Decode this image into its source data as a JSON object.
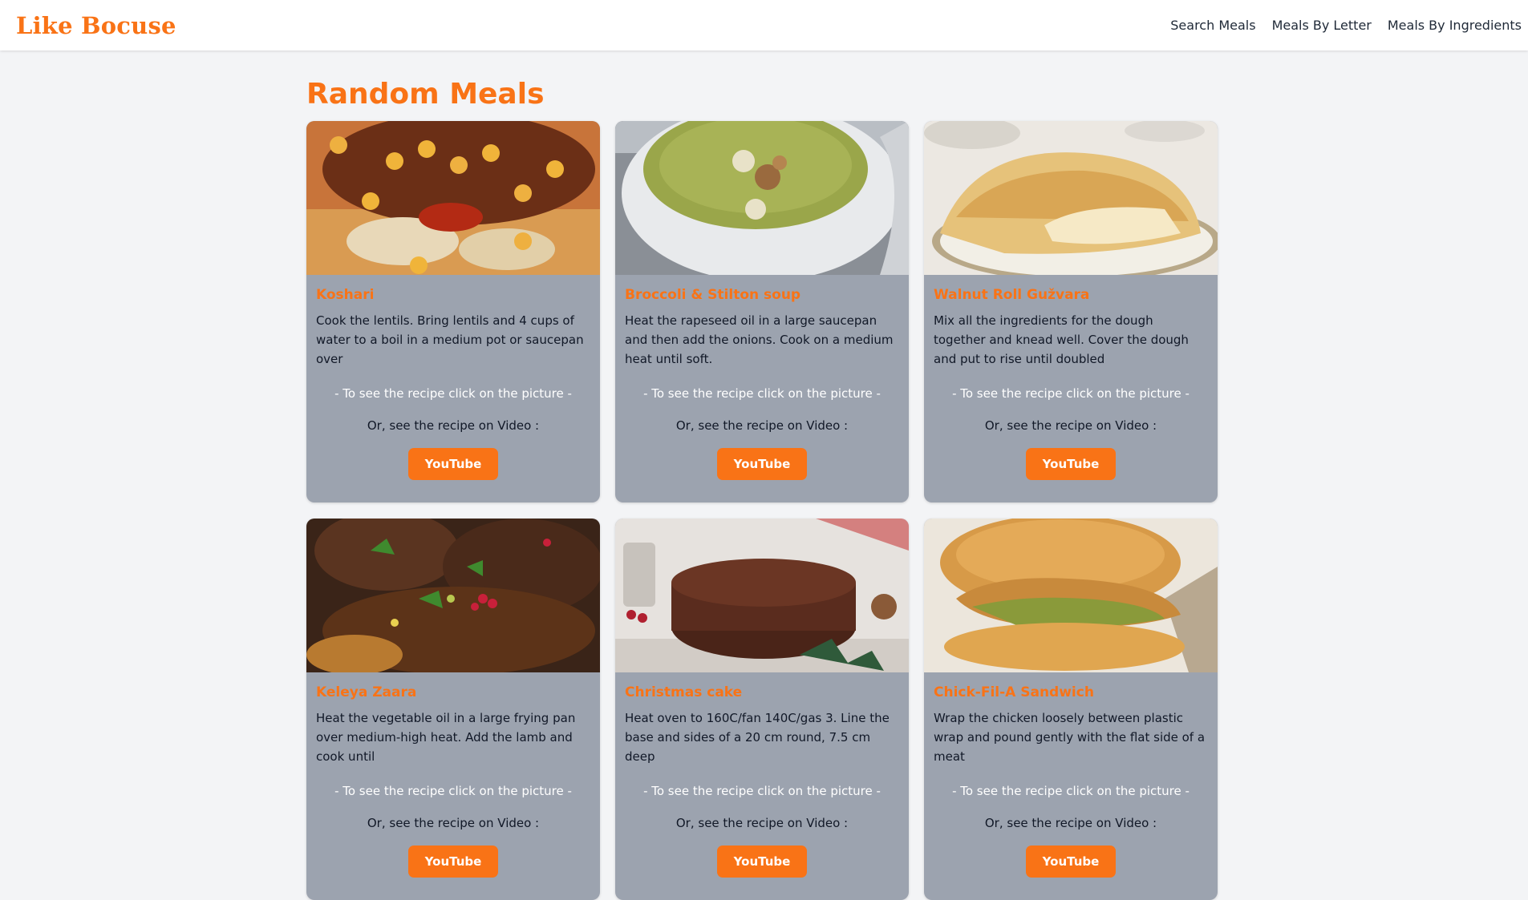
{
  "header": {
    "logo": "Like Bocuse",
    "nav": [
      {
        "label": "Search Meals"
      },
      {
        "label": "Meals By Letter"
      },
      {
        "label": "Meals By Ingredients"
      }
    ]
  },
  "main": {
    "title": "Random Meals",
    "hint_text": "- To see the recipe click on the picture -",
    "video_text": "Or, see the recipe on Video :",
    "youtube_label": "YouTube",
    "meals": [
      {
        "name": "Koshari",
        "description": "Cook the lentils. Bring lentils and 4 cups of water to a boil in a medium pot or saucepan over"
      },
      {
        "name": "Broccoli & Stilton soup",
        "description": "Heat the rapeseed oil in a large saucepan and then add the onions. Cook on a medium heat until soft."
      },
      {
        "name": "Walnut Roll Gužvara",
        "description": "Mix all the ingredients for the dough together and knead well. Cover the dough and put to rise until doubled"
      },
      {
        "name": "Keleya Zaara",
        "description": "Heat the vegetable oil in a large frying pan over medium-high heat. Add the lamb and cook until"
      },
      {
        "name": "Christmas cake",
        "description": "Heat oven to 160C/fan 140C/gas 3. Line the base and sides of a 20 cm round, 7.5 cm deep"
      },
      {
        "name": "Chick-Fil-A Sandwich",
        "description": "Wrap the chicken loosely between plastic wrap and pound gently with the flat side of a meat"
      }
    ]
  },
  "colors": {
    "accent": "#f97316",
    "card_bg": "#9ca3af",
    "page_bg": "#f3f4f6"
  }
}
